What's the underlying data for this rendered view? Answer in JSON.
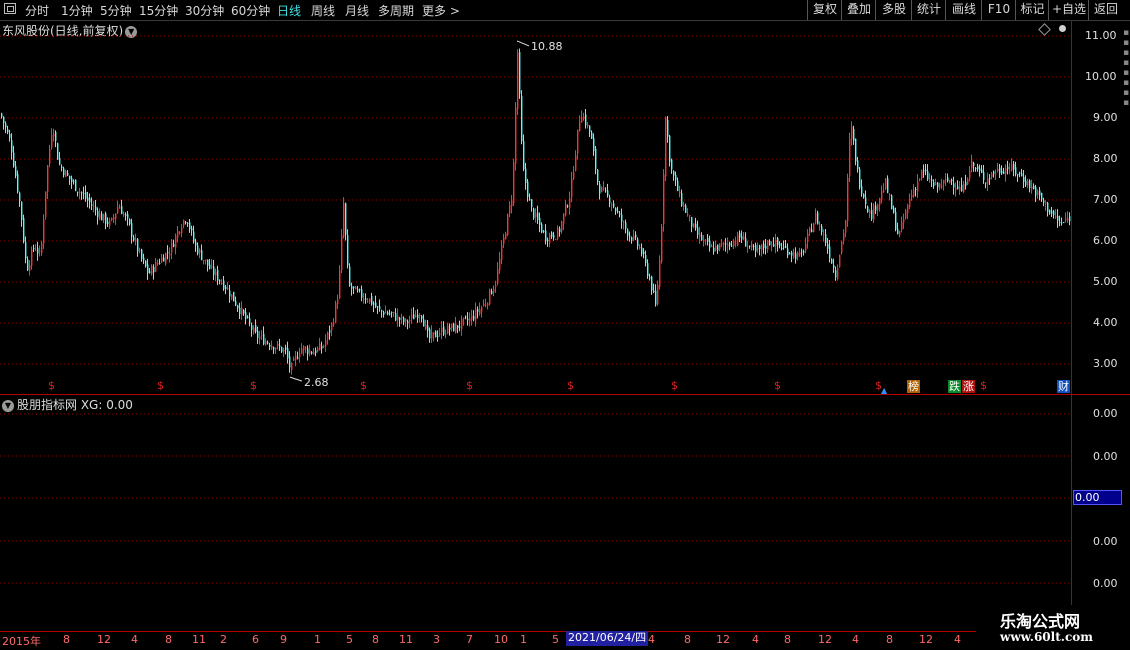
{
  "toolbar": {
    "periods": [
      "分时",
      "1分钟",
      "5分钟",
      "15分钟",
      "30分钟",
      "60分钟",
      "日线",
      "周线",
      "月线",
      "多周期",
      "更多 >"
    ],
    "active": "日线",
    "right_buttons": [
      "复权",
      "叠加",
      "多股",
      "统计",
      "画线",
      "F10",
      "标记",
      "+自选",
      "返回"
    ]
  },
  "main_chart": {
    "title": "东风股份(日线,前复权)",
    "max_label": "10.88",
    "min_label": "2.68",
    "y_ticks": [
      "11.00",
      "10.00",
      "9.00",
      "8.00",
      "7.00",
      "6.00",
      "5.00",
      "4.00",
      "3.00"
    ],
    "markers": [
      "$",
      "$",
      "$",
      "$",
      "$",
      "$",
      "$",
      "$",
      "$",
      "$"
    ],
    "events": [
      "榜",
      "跌",
      "涨",
      "财"
    ],
    "colors": {
      "up": "#ff3232",
      "down": "#54fcfc",
      "grid": "#8b0000",
      "axis": "#b00000"
    }
  },
  "indicator": {
    "title": "股朋指标网 XG: 0.00",
    "y_ticks": [
      "0.00",
      "0.00",
      "0.00",
      "0.00",
      "0.00"
    ],
    "current_value": "0.00"
  },
  "x_axis": {
    "labels": [
      "2015年",
      "8",
      "12",
      "4",
      "8",
      "11",
      "2",
      "6",
      "9",
      "1",
      "5",
      "8",
      "11",
      "3",
      "7",
      "10",
      "1",
      "5",
      "4",
      "8",
      "12",
      "4",
      "8",
      "12",
      "4",
      "8",
      "12",
      "4"
    ],
    "cursor_date": "2021/06/24/四"
  },
  "watermark": {
    "line1": "乐淘公式网",
    "line2": "www.60lt.com"
  },
  "chart_data": {
    "type": "candlestick",
    "title": "东风股份(日线,前复权)",
    "ylim": [
      2.3,
      11.3
    ],
    "max": 10.88,
    "min": 2.68,
    "close_path": [
      [
        0,
        9.1
      ],
      [
        10,
        8.4
      ],
      [
        20,
        6.8
      ],
      [
        26,
        5.3
      ],
      [
        34,
        5.9
      ],
      [
        40,
        5.6
      ],
      [
        46,
        7.6
      ],
      [
        52,
        8.9
      ],
      [
        58,
        7.9
      ],
      [
        66,
        7.6
      ],
      [
        76,
        7.3
      ],
      [
        90,
        6.9
      ],
      [
        100,
        6.6
      ],
      [
        110,
        6.4
      ],
      [
        118,
        6.9
      ],
      [
        128,
        6.4
      ],
      [
        140,
        5.6
      ],
      [
        148,
        5.2
      ],
      [
        158,
        5.5
      ],
      [
        170,
        5.8
      ],
      [
        180,
        6.4
      ],
      [
        186,
        6.6
      ],
      [
        194,
        5.9
      ],
      [
        210,
        5.3
      ],
      [
        225,
        4.9
      ],
      [
        240,
        4.3
      ],
      [
        255,
        3.7
      ],
      [
        270,
        3.5
      ],
      [
        285,
        3.3
      ],
      [
        290,
        2.85
      ],
      [
        300,
        3.4
      ],
      [
        312,
        3.3
      ],
      [
        322,
        3.4
      ],
      [
        332,
        4.0
      ],
      [
        338,
        4.8
      ],
      [
        343,
        6.9
      ],
      [
        348,
        4.9
      ],
      [
        358,
        4.7
      ],
      [
        368,
        4.6
      ],
      [
        378,
        4.3
      ],
      [
        392,
        4.2
      ],
      [
        405,
        4.0
      ],
      [
        420,
        4.3
      ],
      [
        428,
        3.6
      ],
      [
        440,
        3.8
      ],
      [
        455,
        3.9
      ],
      [
        470,
        4.1
      ],
      [
        485,
        4.5
      ],
      [
        495,
        5.0
      ],
      [
        505,
        6.3
      ],
      [
        512,
        7.2
      ],
      [
        517,
        10.6
      ],
      [
        522,
        7.8
      ],
      [
        530,
        6.8
      ],
      [
        545,
        6.1
      ],
      [
        558,
        6.2
      ],
      [
        570,
        7.2
      ],
      [
        580,
        9.2
      ],
      [
        590,
        8.6
      ],
      [
        598,
        7.3
      ],
      [
        610,
        7.0
      ],
      [
        625,
        6.3
      ],
      [
        640,
        5.8
      ],
      [
        650,
        5.0
      ],
      [
        655,
        4.4
      ],
      [
        660,
        5.8
      ],
      [
        665,
        9.0
      ],
      [
        670,
        7.8
      ],
      [
        680,
        7.0
      ],
      [
        695,
        6.2
      ],
      [
        710,
        5.8
      ],
      [
        725,
        5.9
      ],
      [
        740,
        6.1
      ],
      [
        755,
        5.7
      ],
      [
        770,
        6.0
      ],
      [
        785,
        5.8
      ],
      [
        800,
        5.6
      ],
      [
        815,
        6.6
      ],
      [
        825,
        6.0
      ],
      [
        835,
        5.2
      ],
      [
        845,
        6.5
      ],
      [
        850,
        8.9
      ],
      [
        858,
        7.5
      ],
      [
        870,
        6.6
      ],
      [
        885,
        7.4
      ],
      [
        898,
        6.1
      ],
      [
        910,
        7.1
      ],
      [
        922,
        7.7
      ],
      [
        935,
        7.3
      ],
      [
        950,
        7.5
      ],
      [
        962,
        7.2
      ],
      [
        970,
        7.9
      ],
      [
        985,
        7.5
      ],
      [
        995,
        7.7
      ],
      [
        1008,
        7.8
      ],
      [
        1020,
        7.6
      ],
      [
        1035,
        7.2
      ],
      [
        1050,
        6.7
      ],
      [
        1060,
        6.4
      ],
      [
        1070,
        6.6
      ]
    ]
  }
}
